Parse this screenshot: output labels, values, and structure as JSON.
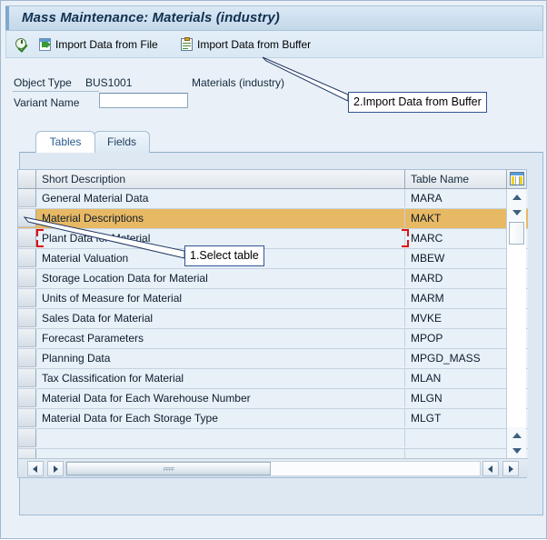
{
  "window": {
    "title": "Mass Maintenance: Materials (industry)"
  },
  "toolbar": {
    "execute_icon": "execute-clock-check-icon",
    "import_file_label": "Import Data from File",
    "import_file_icon": "import-file-icon",
    "import_buffer_label": "Import Data from Buffer",
    "import_buffer_icon": "import-buffer-clipboard-icon"
  },
  "form": {
    "object_type_label": "Object Type",
    "object_type_value": "BUS1001",
    "object_type_description": "Materials (industry)",
    "variant_name_label": "Variant Name",
    "variant_name_value": "",
    "variant_name_placeholder": ""
  },
  "tabs": [
    {
      "label": "Tables",
      "active": true
    },
    {
      "label": "Fields",
      "active": false
    }
  ],
  "grid": {
    "columns": [
      {
        "label": "Short Description",
        "key": "short_description"
      },
      {
        "label": "Table Name",
        "key": "table_name"
      }
    ],
    "config_icon": "table-column-settings-icon",
    "rows": [
      {
        "short_description": "General Material Data",
        "table_name": "MARA",
        "selected": false,
        "focused": false
      },
      {
        "short_description": "Material Descriptions",
        "table_name": "MAKT",
        "selected": true,
        "focused": false
      },
      {
        "short_description": "Plant Data for Material",
        "table_name": "MARC",
        "selected": false,
        "focused": true
      },
      {
        "short_description": "Material Valuation",
        "table_name": "MBEW",
        "selected": false,
        "focused": false
      },
      {
        "short_description": "Storage Location Data for Material",
        "table_name": "MARD",
        "selected": false,
        "focused": false
      },
      {
        "short_description": "Units of Measure for Material",
        "table_name": "MARM",
        "selected": false,
        "focused": false
      },
      {
        "short_description": "Sales Data for Material",
        "table_name": "MVKE",
        "selected": false,
        "focused": false
      },
      {
        "short_description": "Forecast Parameters",
        "table_name": "MPOP",
        "selected": false,
        "focused": false
      },
      {
        "short_description": "Planning Data",
        "table_name": "MPGD_MASS",
        "selected": false,
        "focused": false
      },
      {
        "short_description": "Tax Classification for Material",
        "table_name": "MLAN",
        "selected": false,
        "focused": false
      },
      {
        "short_description": "Material Data for Each Warehouse Number",
        "table_name": "MLGN",
        "selected": false,
        "focused": false
      },
      {
        "short_description": "Material Data for Each Storage Type",
        "table_name": "MLGT",
        "selected": false,
        "focused": false
      },
      {
        "short_description": "",
        "table_name": "",
        "selected": false,
        "focused": false
      },
      {
        "short_description": "",
        "table_name": "",
        "selected": false,
        "focused": false
      },
      {
        "short_description": "",
        "table_name": "",
        "selected": false,
        "focused": false
      },
      {
        "short_description": "",
        "table_name": "",
        "selected": false,
        "focused": false
      }
    ]
  },
  "annotations": [
    {
      "id": "callout-buffer",
      "text": "2.Import Data from Buffer"
    },
    {
      "id": "callout-select",
      "text": "1.Select table"
    }
  ],
  "colors": {
    "selected_row": "#e8b964",
    "title_text": "#11304f",
    "annotation_border": "#2f5496",
    "focus_marker": "#dd1111",
    "window_bg": "#e9f0f7"
  }
}
